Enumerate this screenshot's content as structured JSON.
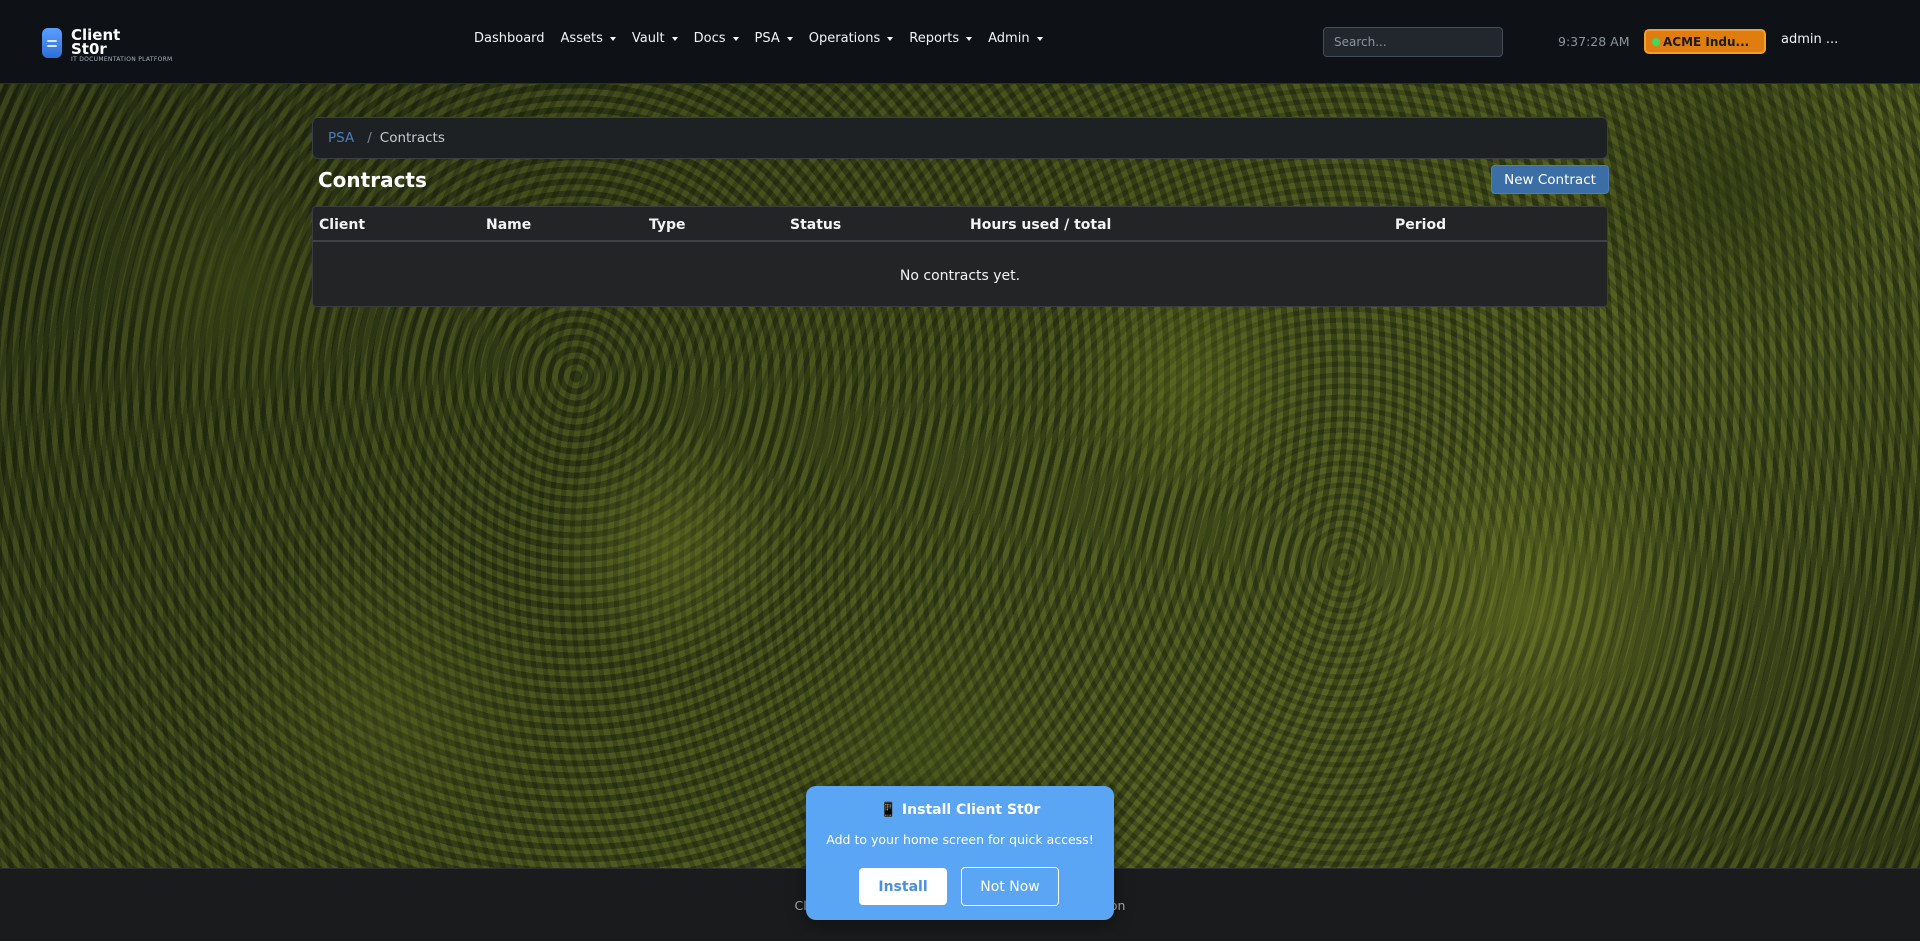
{
  "brand": {
    "name": "Client St0r",
    "tagline": "IT DOCUMENTATION PLATFORM"
  },
  "nav": {
    "items": [
      {
        "label": "Dashboard",
        "dropdown": false
      },
      {
        "label": "Assets",
        "dropdown": true
      },
      {
        "label": "Vault",
        "dropdown": true
      },
      {
        "label": "Docs",
        "dropdown": true
      },
      {
        "label": "PSA",
        "dropdown": true
      },
      {
        "label": "Operations",
        "dropdown": true
      },
      {
        "label": "Reports",
        "dropdown": true
      },
      {
        "label": "Admin",
        "dropdown": true
      }
    ],
    "search_placeholder": "Search...",
    "clock": "9:37:28 AM",
    "org": "ACME Indu...",
    "org_status_color": "#3ddc5e",
    "user": "admin ..."
  },
  "breadcrumb": {
    "parent": "PSA",
    "separator": "/",
    "current": "Contracts"
  },
  "page": {
    "title": "Contracts",
    "new_button": "New Contract"
  },
  "table": {
    "columns": [
      "Client",
      "Name",
      "Type",
      "Status",
      "Hours used / total",
      "Period"
    ],
    "empty_message": "No contracts yet."
  },
  "footer": {
    "text_left": "Clien",
    "text_right": "ation"
  },
  "install_prompt": {
    "icon": "mobile-phone-icon",
    "title": "📱 Install Client St0r",
    "description": "Add to your home screen for quick access!",
    "install_label": "Install",
    "dismiss_label": "Not Now"
  },
  "colors": {
    "navbar_bg": "#0e1217",
    "accent": "#3b6ea5",
    "org_badge": "#e07d0e",
    "install_prompt_bg": "#5aa6f5"
  }
}
